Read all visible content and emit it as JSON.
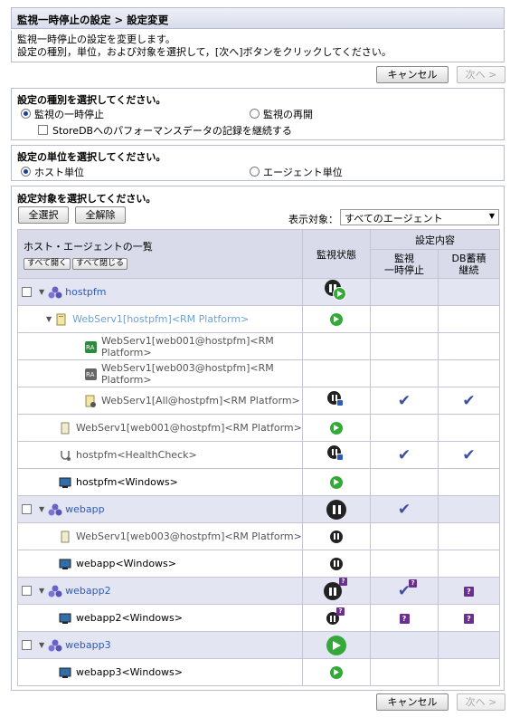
{
  "breadcrumb": "監視一時停止の設定 > 設定変更",
  "description": [
    "監視一時停止の設定を変更します。",
    "設定の種別，単位，および対象を選択して，[次へ]ボタンをクリックしてください。"
  ],
  "buttons": {
    "cancel": "キャンセル",
    "next": "次へ >"
  },
  "kind": {
    "heading": "設定の種別を選択してください。",
    "pause": "監視の一時停止",
    "resume": "監視の再開",
    "storedb": "StoreDBへのパフォーマンスデータの記録を継続する"
  },
  "unit": {
    "heading": "設定の単位を選択してください。",
    "host": "ホスト単位",
    "agent": "エージェント単位"
  },
  "target": {
    "heading": "設定対象を選択してください。",
    "select_all": "全選択",
    "deselect_all": "全解除",
    "filter_label": "表示対象：",
    "filter_value": "すべてのエージェント"
  },
  "table": {
    "col_list": "ホスト・エージェントの一覧",
    "expand_all": "すべて開く",
    "collapse_all": "すべて閉じる",
    "col_status": "監視状態",
    "col_settings": "設定内容",
    "col_pause": "監視\n一時停止",
    "col_db": "DB蓄積\n継続",
    "rows": [
      {
        "type": "group",
        "name": "hostpfm",
        "status": "pause-play",
        "pause": "",
        "db": ""
      },
      {
        "type": "agent",
        "indent": 1,
        "name": "WebServ1[hostpfm]<RM Platform>",
        "icon": "folder-icon",
        "status": "play",
        "pause": "",
        "db": ""
      },
      {
        "type": "agent",
        "indent": 2,
        "name": "WebServ1[web001@hostpfm]<RM Platform>",
        "icon": "ra-green-icon",
        "status": "",
        "pause": "",
        "db": ""
      },
      {
        "type": "agent",
        "indent": 2,
        "name": "WebServ1[web003@hostpfm]<RM Platform>",
        "icon": "ra-gray-icon",
        "status": "",
        "pause": "",
        "db": ""
      },
      {
        "type": "agent",
        "indent": 2,
        "name": "WebServ1[All@hostpfm]<RM Platform>",
        "icon": "agent-doc-icon",
        "status": "pause-sub",
        "pause": "check",
        "db": "check"
      },
      {
        "type": "agent",
        "indent": 1,
        "name": "WebServ1[web001@hostpfm]<RM Platform>",
        "icon": "server-icon",
        "status": "play",
        "pause": "",
        "db": ""
      },
      {
        "type": "agent",
        "indent": 1,
        "name": "hostpfm<HealthCheck>",
        "icon": "stethoscope-icon",
        "status": "pause-sub",
        "pause": "check",
        "db": "check"
      },
      {
        "type": "agent",
        "indent": 1,
        "name": "hostpfm<Windows>",
        "icon": "monitor-icon",
        "status": "play",
        "pause": "",
        "db": "",
        "dark": true
      },
      {
        "type": "group",
        "name": "webapp",
        "status": "pause-big",
        "pause": "check",
        "db": ""
      },
      {
        "type": "agent",
        "indent": 1,
        "name": "WebServ1[web003@hostpfm]<RM Platform>",
        "icon": "server-icon",
        "status": "pause",
        "pause": "",
        "db": ""
      },
      {
        "type": "agent",
        "indent": 1,
        "name": "webapp<Windows>",
        "icon": "monitor-icon",
        "status": "pause",
        "pause": "",
        "db": "",
        "dark": true
      },
      {
        "type": "group",
        "name": "webapp2",
        "status": "pause-q-big",
        "pause": "check-q",
        "db": "q"
      },
      {
        "type": "agent",
        "indent": 1,
        "name": "webapp2<Windows>",
        "icon": "monitor-icon",
        "status": "pause-q",
        "pause": "q",
        "db": "q",
        "dark": true
      },
      {
        "type": "group",
        "name": "webapp3",
        "status": "play-big",
        "pause": "",
        "db": ""
      },
      {
        "type": "agent",
        "indent": 1,
        "name": "webapp3<Windows>",
        "icon": "monitor-icon",
        "status": "play",
        "pause": "",
        "db": "",
        "dark": true
      }
    ]
  }
}
